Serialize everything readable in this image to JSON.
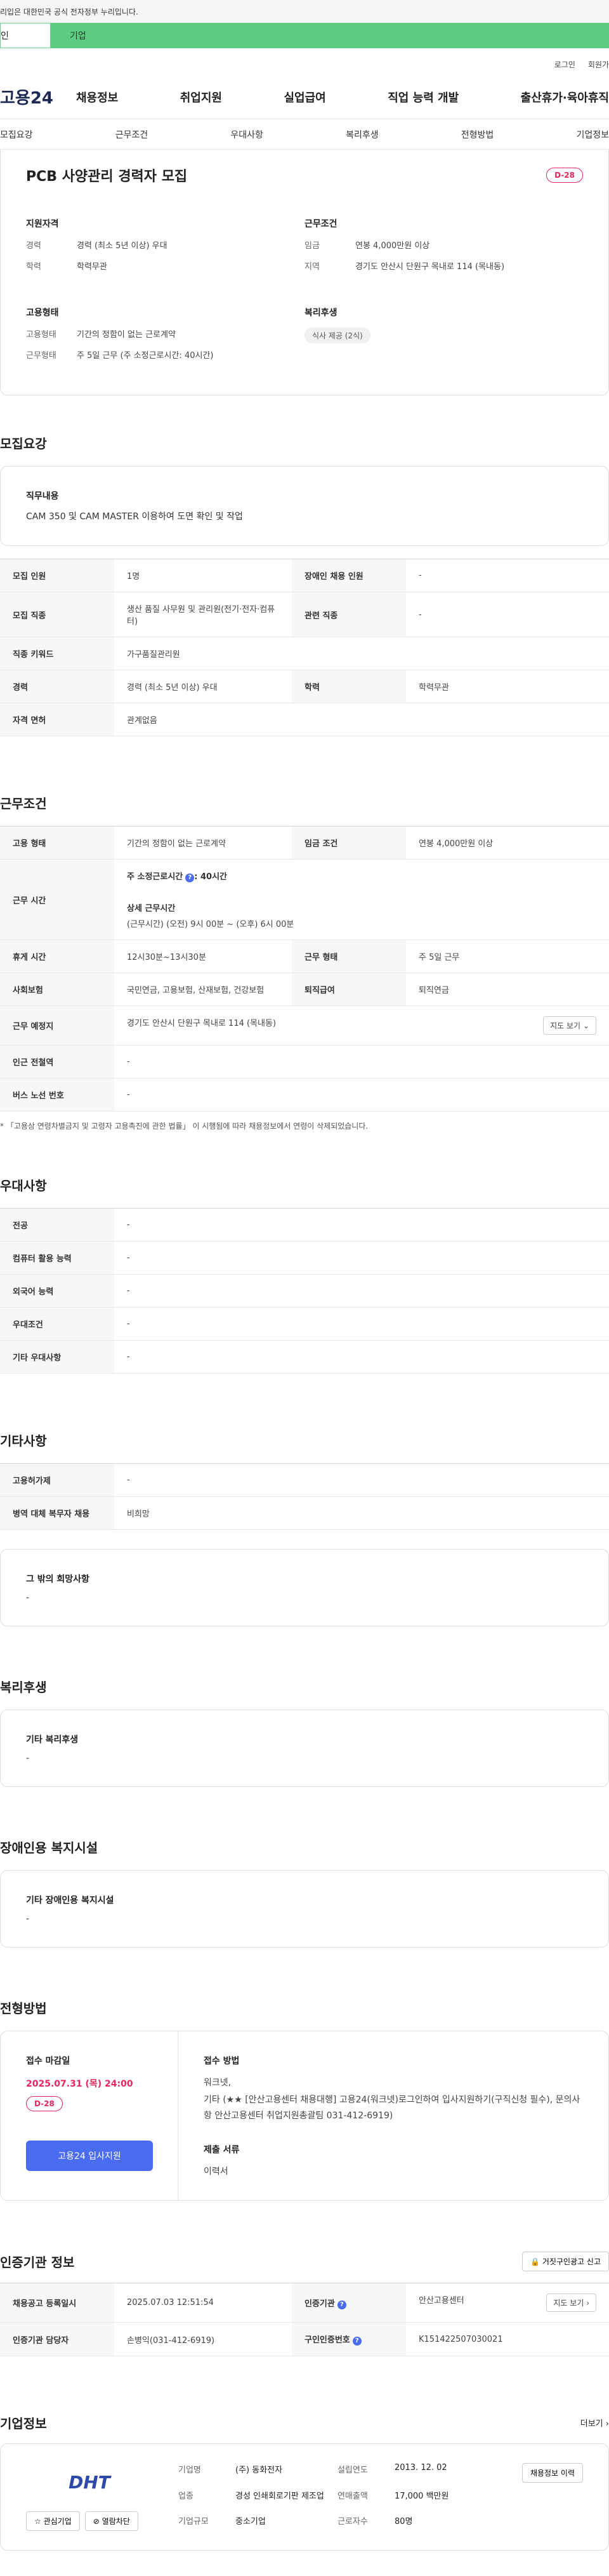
{
  "top_notice": "리입은 대한민국 공식 전자정부 누리입니다.",
  "tabs_top": [
    "인",
    "기업"
  ],
  "util": [
    "로그인",
    "회원가"
  ],
  "logo": "고용24",
  "gnb": [
    "채용정보",
    "취업지원",
    "실업급여",
    "직업 능력 개발",
    "출산휴가·육아휴직"
  ],
  "subnav": [
    "모집요강",
    "근무조건",
    "우대사항",
    "복리후생",
    "전형방법",
    "기업정보"
  ],
  "summary": {
    "title": "PCB 사양관리 경력자 모집",
    "dday": "D-28",
    "qual_h": "지원자격",
    "qual": [
      {
        "k": "경력",
        "v": "경력 (최소 5년 이상) 우대"
      },
      {
        "k": "학력",
        "v": "학력무관"
      }
    ],
    "cond_h": "근무조건",
    "cond": [
      {
        "k": "임금",
        "v": "연봉 4,000만원 이상"
      },
      {
        "k": "지역",
        "v": "경기도 안산시 단원구 목내로 114 (목내동)"
      }
    ],
    "emp_h": "고용형태",
    "emp": [
      {
        "k": "고용형태",
        "v": "기간의 정함이 없는 근로계약"
      },
      {
        "k": "근무형태",
        "v": "주 5일 근무 (주 소정근로시간: 40시간)"
      }
    ],
    "welfare_h": "복리후생",
    "welfare_chip": "식사 제공 (2식)"
  },
  "recruit": {
    "title": "모집요강",
    "duty_label": "직무내용",
    "duty": "CAM 350 및 CAM MASTER 이용하여 도면 확인 및 작업",
    "rows": [
      [
        "모집 인원",
        "1명",
        "장애인 채용 인원",
        "-"
      ],
      [
        "모집 직종",
        "생산 품질 사무원 및 관리원(전기·전자·컴퓨터)",
        "관련 직종",
        "-"
      ],
      [
        "직종 키워드",
        "가구품질관리원",
        "",
        ""
      ],
      [
        "경력",
        "경력 (최소 5년 이상) 우대",
        "학력",
        "학력무관"
      ],
      [
        "자격 면허",
        "관계없음",
        "",
        ""
      ]
    ]
  },
  "work": {
    "title": "근무조건",
    "type_k": "고용 형태",
    "type_v": "기간의 정함이 없는 근로계약",
    "pay_k": "임금 조건",
    "pay_v": "연봉 4,000만원 이상",
    "hours_k": "근무 시간",
    "hours_main": "주 소정근로시간",
    "hours_main_v": ": 40시간",
    "hours_detail_h": "상세 근무시간",
    "hours_detail": "(근무시간) (오전) 9시 00분 ~ (오후) 6시 00분",
    "rest_k": "휴게 시간",
    "rest_v": "12시30분~13시30분",
    "form_k": "근무 형태",
    "form_v": "주 5일 근무",
    "ins_k": "사회보험",
    "ins_v": "국민연금, 고용보험, 산재보험, 건강보험",
    "ret_k": "퇴직급여",
    "ret_v": "퇴직연금",
    "loc_k": "근무 예정지",
    "loc_v": "경기도 안산시 단원구 목내로 114 (목내동)",
    "map": "지도 보기",
    "sub_k": "인근 전철역",
    "sub_v": "-",
    "bus_k": "버스 노선 번호",
    "bus_v": "-",
    "note": "* 「고용상 연령차별금지 및 고령자 고용촉진에 관한 법률」 이 시행됨에 따라 채용정보에서 연령이 삭제되었습니다."
  },
  "prefer": {
    "title": "우대사항",
    "rows": [
      [
        "전공",
        "-"
      ],
      [
        "컴퓨터 활용 능력",
        "-"
      ],
      [
        "외국어 능력",
        "-"
      ],
      [
        "우대조건",
        "-"
      ],
      [
        "기타 우대사항",
        "-"
      ]
    ]
  },
  "etc": {
    "title": "기타사항",
    "rows": [
      [
        "고용허가제",
        "-"
      ],
      [
        "병역 대체 복무자 채용",
        "비희망"
      ]
    ],
    "box_label": "그 밖의 희망사항",
    "box_val": "-"
  },
  "welfare": {
    "title": "복리후생",
    "label": "기타 복리후생",
    "val": "-"
  },
  "disabled": {
    "title": "장애인용 복지시설",
    "label": "기타 장애인용 복지시설",
    "val": "-"
  },
  "screen": {
    "title": "전형방법",
    "deadline_h": "접수 마감일",
    "deadline": "2025.07.31 (목) 24:00",
    "dday": "D-28",
    "apply_btn": "고용24 입사지원",
    "method_h": "접수 방법",
    "method_1": "워크넷,",
    "method_2": "기타 (★★ [안산고용센터 채용대행] 고용24(워크넷)로그인하여 입사지원하기(구직신청 필수), 문의사항 안산고용센터 취업지원총괄팀 031-412-6919)",
    "docs_h": "제출 서류",
    "docs": "이력서"
  },
  "cert": {
    "title": "인증기관 정보",
    "report": "거짓구인광고 신고",
    "rows": [
      [
        "채용공고 등록일시",
        "2025.07.03 12:51:54",
        "인증기관",
        "안산고용센터"
      ],
      [
        "인증기관 담당자",
        "손병익(031-412-6919)",
        "구인인증번호",
        "K151422507030021"
      ]
    ],
    "map": "지도 보기"
  },
  "company": {
    "title": "기업정보",
    "more": "더보기",
    "logo_text": "DHT",
    "fav": "관심기업",
    "block": "열람차단",
    "name_k": "기업명",
    "name_v": "(주) 동화전자",
    "ind_k": "업종",
    "ind_v": "경성 인쇄회로기판 제조업",
    "size_k": "기업규모",
    "size_v": "중소기업",
    "year_k": "설립연도",
    "year_v": "2013. 12. 02",
    "sales_k": "연매출액",
    "sales_v": "17,000 백만원",
    "emp_k": "근로자수",
    "emp_v": "80명",
    "history": "채용정보 이력"
  }
}
